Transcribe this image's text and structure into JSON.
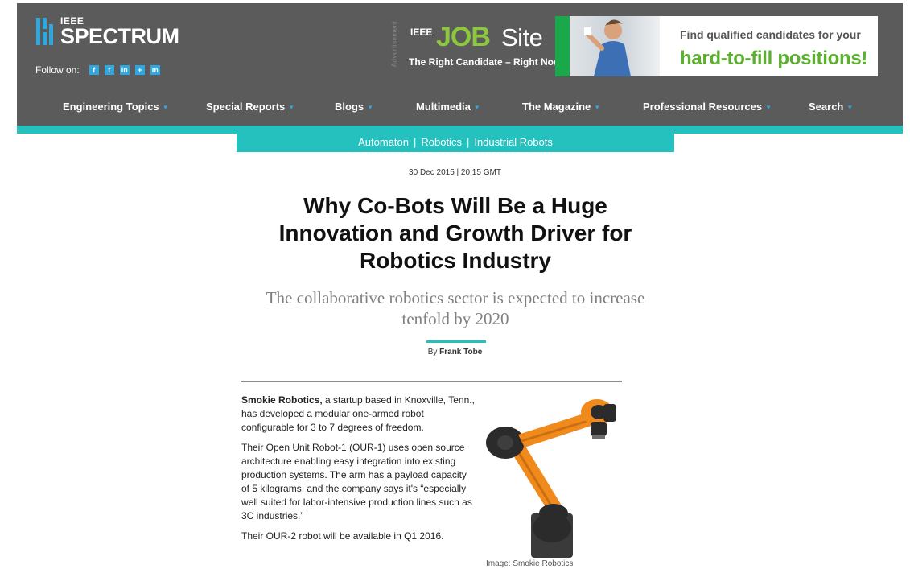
{
  "brand": {
    "ieee": "IEEE",
    "name": "SPECTRUM",
    "follow_label": "Follow on:",
    "social": [
      {
        "glyph": "f",
        "name": "facebook"
      },
      {
        "glyph": "t",
        "name": "twitter"
      },
      {
        "glyph": "in",
        "name": "linkedin"
      },
      {
        "glyph": "+",
        "name": "google-plus"
      },
      {
        "glyph": "m",
        "name": "rss"
      }
    ]
  },
  "ad": {
    "label": "Advertisement",
    "ieee": "IEEE",
    "job": "JOB",
    "site": "Site",
    "tagline": "The Right Candidate – Right Now!",
    "find": "Find qualified candidates for your",
    "hard": "hard-to-fill positions!"
  },
  "nav": {
    "items": [
      {
        "label": "Engineering Topics"
      },
      {
        "label": "Special Reports"
      },
      {
        "label": "Blogs"
      },
      {
        "label": "Multimedia"
      },
      {
        "label": "The Magazine"
      },
      {
        "label": "Professional Resources"
      },
      {
        "label": "Search"
      }
    ]
  },
  "subnav": {
    "items": [
      "Automaton",
      "Robotics",
      "Industrial Robots"
    ],
    "separator": "|"
  },
  "article": {
    "dateline": "30 Dec 2015 | 20:15 GMT",
    "title": "Why Co-Bots Will Be a Huge Innovation and Growth Driver for Robotics Industry",
    "dek": "The collaborative robotics sector is expected to increase tenfold by 2020",
    "byline_prefix": "By",
    "author": "Frank Tobe",
    "p1_lead": "Smokie Robotics,",
    "p1_rest": " a startup based in Knoxville, Tenn., has developed a modular one-armed robot configurable for 3 to 7 degrees of freedom.",
    "p2": "Their Open Unit Robot-1 (OUR-1) uses open source architecture enabling easy integration into existing production systems. The arm has a payload capacity of 5 kilograms, and the company says it's “especially well suited for labor-intensive production lines such as 3C industries.”",
    "p3": "Their OUR-2 robot will be available in Q1 2016.",
    "image_caption": "Image: Smokie Robotics"
  },
  "colors": {
    "header_bg": "#5b5b5b",
    "accent_teal": "#24c1bf",
    "brand_blue": "#2fa8e0",
    "job_green": "#8dc63f",
    "ad_green": "#5cb030",
    "robot_orange": "#f08a1c"
  }
}
